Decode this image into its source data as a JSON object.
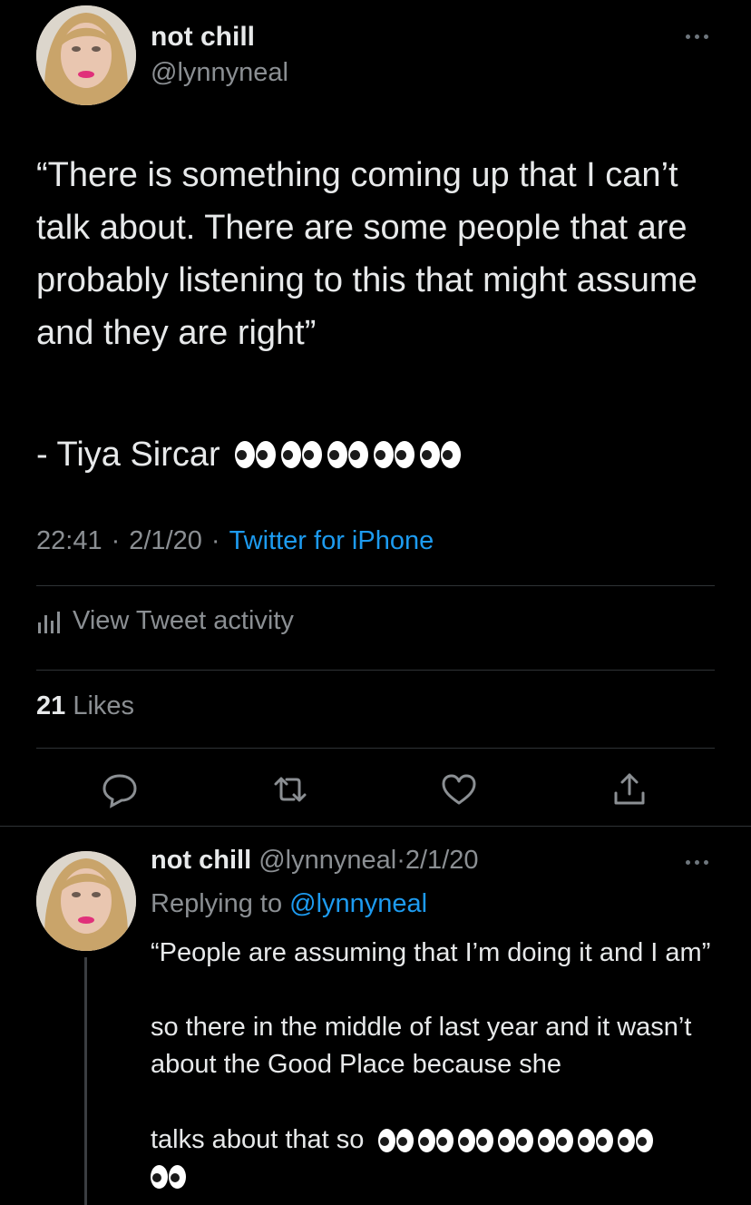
{
  "main_tweet": {
    "name": "not chill",
    "handle": "@lynnyneal",
    "text": "“There is something coming up that I can’t talk about. There are some people that are probably listening to this that might assume and they are right”",
    "attribution": "- Tiya Sircar",
    "attribution_emoji_count": 5,
    "time": "22:41",
    "date": "2/1/20",
    "separator": "·",
    "source": "Twitter for iPhone",
    "activity_label": "View Tweet activity",
    "likes_count": "21",
    "likes_label": "Likes",
    "actions": [
      "reply-icon",
      "retweet-icon",
      "like-icon",
      "share-icon"
    ]
  },
  "reply_tweet": {
    "name": "not chill",
    "handle": "@lynnyneal",
    "separator": "·",
    "date": "2/1/20",
    "replying_prefix": "Replying to",
    "replying_to": "@lynnyneal",
    "text": "“People are assuming that I’m doing it and I am”\n\nso there in the middle of last year and it wasn’t about the Good Place because she",
    "tail_text": "talks about that so",
    "tail_emoji_count": 7,
    "second_line_emoji_count": 1
  },
  "colors": {
    "background": "#000000",
    "text_primary": "#e7e9ea",
    "text_secondary": "#8b8f93",
    "link": "#1d9bf0",
    "divider": "#2f3336"
  }
}
